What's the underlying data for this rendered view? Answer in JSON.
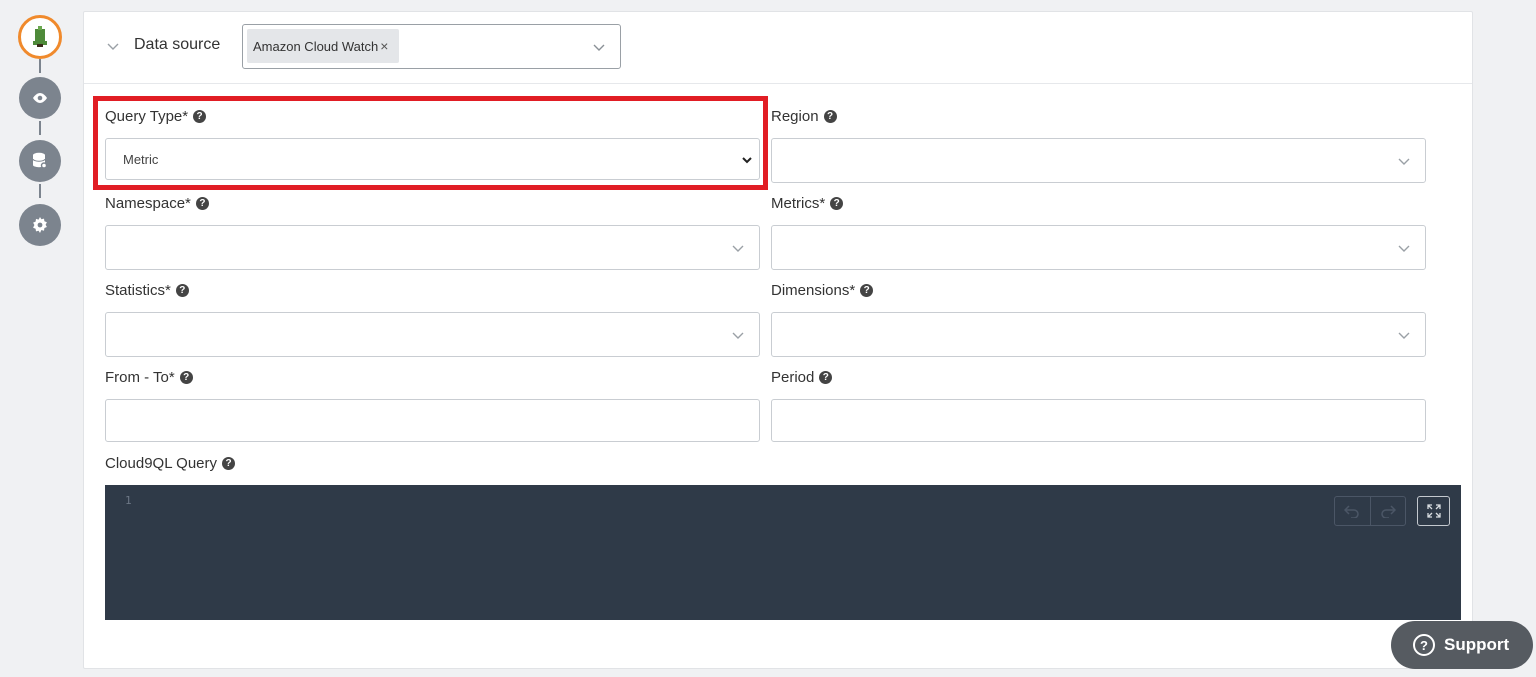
{
  "datasource": {
    "label": "Data source",
    "chip": "Amazon Cloud Watch",
    "chip_remove": "×"
  },
  "fields": {
    "query_type": {
      "label": "Query Type*",
      "value": "Metric"
    },
    "region": {
      "label": "Region"
    },
    "namespace": {
      "label": "Namespace*"
    },
    "metrics": {
      "label": "Metrics*"
    },
    "statistics": {
      "label": "Statistics*"
    },
    "dimensions": {
      "label": "Dimensions*"
    },
    "from_to": {
      "label": "From - To*"
    },
    "period": {
      "label": "Period"
    },
    "cloud9ql": {
      "label": "Cloud9QL Query"
    }
  },
  "editor": {
    "line_number": "1"
  },
  "help_glyph": "?",
  "support": {
    "label": "Support",
    "glyph": "?"
  },
  "colors": {
    "accent_orange": "#f08a2c",
    "highlight_red": "#e11d24",
    "editor_bg": "#2f3a48",
    "rail_gray": "#7c848e"
  }
}
